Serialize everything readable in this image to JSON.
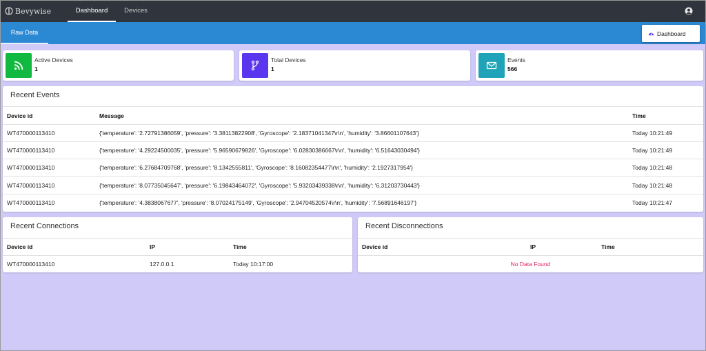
{
  "brand": {
    "name": "Bevywise"
  },
  "nav": {
    "dashboard": "Dashboard",
    "devices": "Devices",
    "user_icon": "user-circle-icon"
  },
  "subbar": {
    "tab": "Raw Data",
    "dashboard_button": "Dashboard"
  },
  "colors": {
    "green": "#12b940",
    "purple": "#5a37ee",
    "teal": "#1fa3b8",
    "blue_bar": "#2b88d2",
    "nav": "#30343d",
    "background": "#cfcaf8",
    "no_data": "#e0245e"
  },
  "stats": [
    {
      "label": "Active Devices",
      "value": "1",
      "icon": "rss-icon"
    },
    {
      "label": "Total Devices",
      "value": "1",
      "icon": "branch-icon"
    },
    {
      "label": "Events",
      "value": "566",
      "icon": "envelope-icon"
    }
  ],
  "events": {
    "title": "Recent Events",
    "columns": [
      "Device id",
      "Message",
      "Time"
    ],
    "rows": [
      [
        "WT470000113410",
        "{'temperature': '2.72791386059', 'pressure': '3.38113822908', 'Gyroscope': '2.18371041347\\r\\n', 'humidity': '3.86601107643'}",
        "Today 10:21:49"
      ],
      [
        "WT470000113410",
        "{'temperature': '4.29224500035', 'pressure': '5.96590679826', 'Gyroscope': '6.02830386667\\r\\n', 'humidity': '6.51643030494'}",
        "Today 10:21:49"
      ],
      [
        "WT470000113410",
        "{'temperature': '6.27684709768', 'pressure': '8.1342555811', 'Gyroscope': '8.16082354477\\r\\n', 'humidity': '2.1927317954'}",
        "Today 10:21:48"
      ],
      [
        "WT470000113410",
        "{'temperature': '8.07735045647', 'pressure': '6.19843464072', 'Gyroscope': '5.93203439338\\r\\n', 'humidity': '6.31203730443'}",
        "Today 10:21:48"
      ],
      [
        "WT470000113410",
        "{'temperature': '4.3838067677', 'pressure': '8.07024175149', 'Gyroscope': '2.94704520574\\r\\n', 'humidity': '7.56891646197'}",
        "Today 10:21:47"
      ]
    ]
  },
  "connections": {
    "title": "Recent Connections",
    "columns": [
      "Device id",
      "IP",
      "Time"
    ],
    "rows": [
      [
        "WT470000113410",
        "127.0.0.1",
        "Today 10:17:00"
      ]
    ]
  },
  "disconnections": {
    "title": "Recent Disconnections",
    "columns": [
      "Device id",
      "IP",
      "Time"
    ],
    "empty_text": "No Data Found"
  }
}
